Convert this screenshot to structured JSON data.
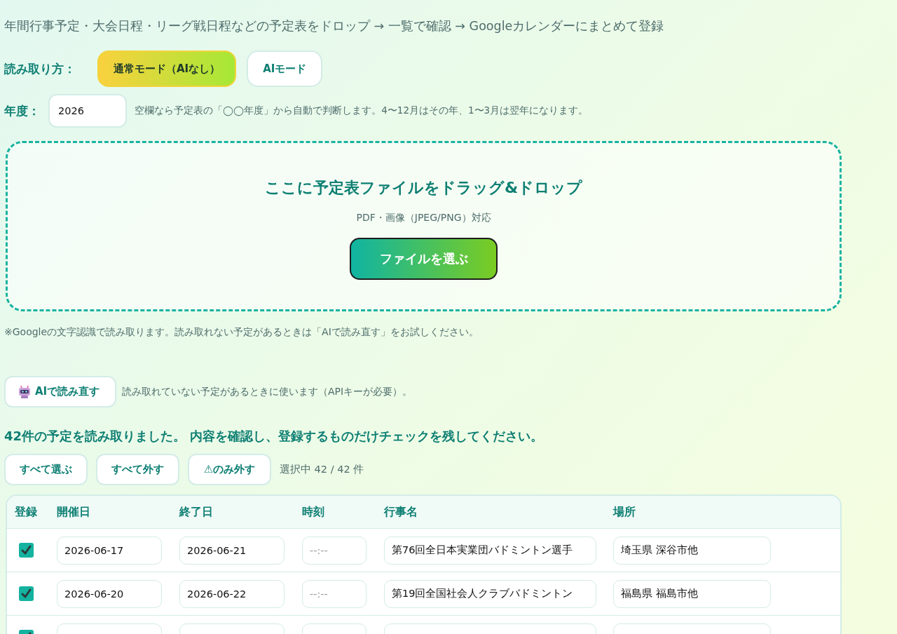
{
  "subtitle": "年間行事予定・大会日程・リーグ戦日程などの予定表をドロップ → 一覧で確認 → Googleカレンダーにまとめて登録",
  "read_mode": {
    "label": "読み取り方：",
    "options": [
      {
        "label": "通常モード（AIなし）",
        "selected": true
      },
      {
        "label": "AIモード",
        "selected": false
      }
    ]
  },
  "year": {
    "label": "年度：",
    "value": "2026",
    "hint": "空欄なら予定表の「◯◯年度」から自動で判断します。4〜12月はその年、1〜3月は翌年になります。"
  },
  "dropzone": {
    "title": "ここに予定表ファイルをドラッグ&ドロップ",
    "formats": "PDF・画像（JPEG/PNG）対応",
    "button": "ファイルを選ぶ"
  },
  "note": "※Googleの文字認識で読み取ります。読み取れない予定があるときは「AIで読み直す」をお試しください。",
  "ai_reread": {
    "button": "AIで読み直す",
    "hint": "読み取れていない予定があるときに使います（APIキーが必要）。"
  },
  "result_message": "42件の予定を読み取りました。 内容を確認し、登録するものだけチェックを残してください。",
  "bulk_buttons": [
    "すべて選ぶ",
    "すべて外す",
    "⚠のみ外す"
  ],
  "selection_count": "選択中 42 / 42 件",
  "table": {
    "columns": [
      "登録",
      "開催日",
      "終了日",
      "時刻",
      "行事名",
      "場所"
    ],
    "rows": [
      {
        "checked": true,
        "start": "2026-06-17",
        "end": "2026-06-21",
        "time_placeholder": "--:--",
        "name": "第76回全日本実業団バドミントン選手",
        "place": "埼玉県 深谷市他"
      },
      {
        "checked": true,
        "start": "2026-06-20",
        "end": "2026-06-22",
        "time_placeholder": "--:--",
        "name": "第19回全国社会人クラブバドミントン",
        "place": "福島県 福島市他"
      },
      {
        "checked": true
      }
    ]
  }
}
